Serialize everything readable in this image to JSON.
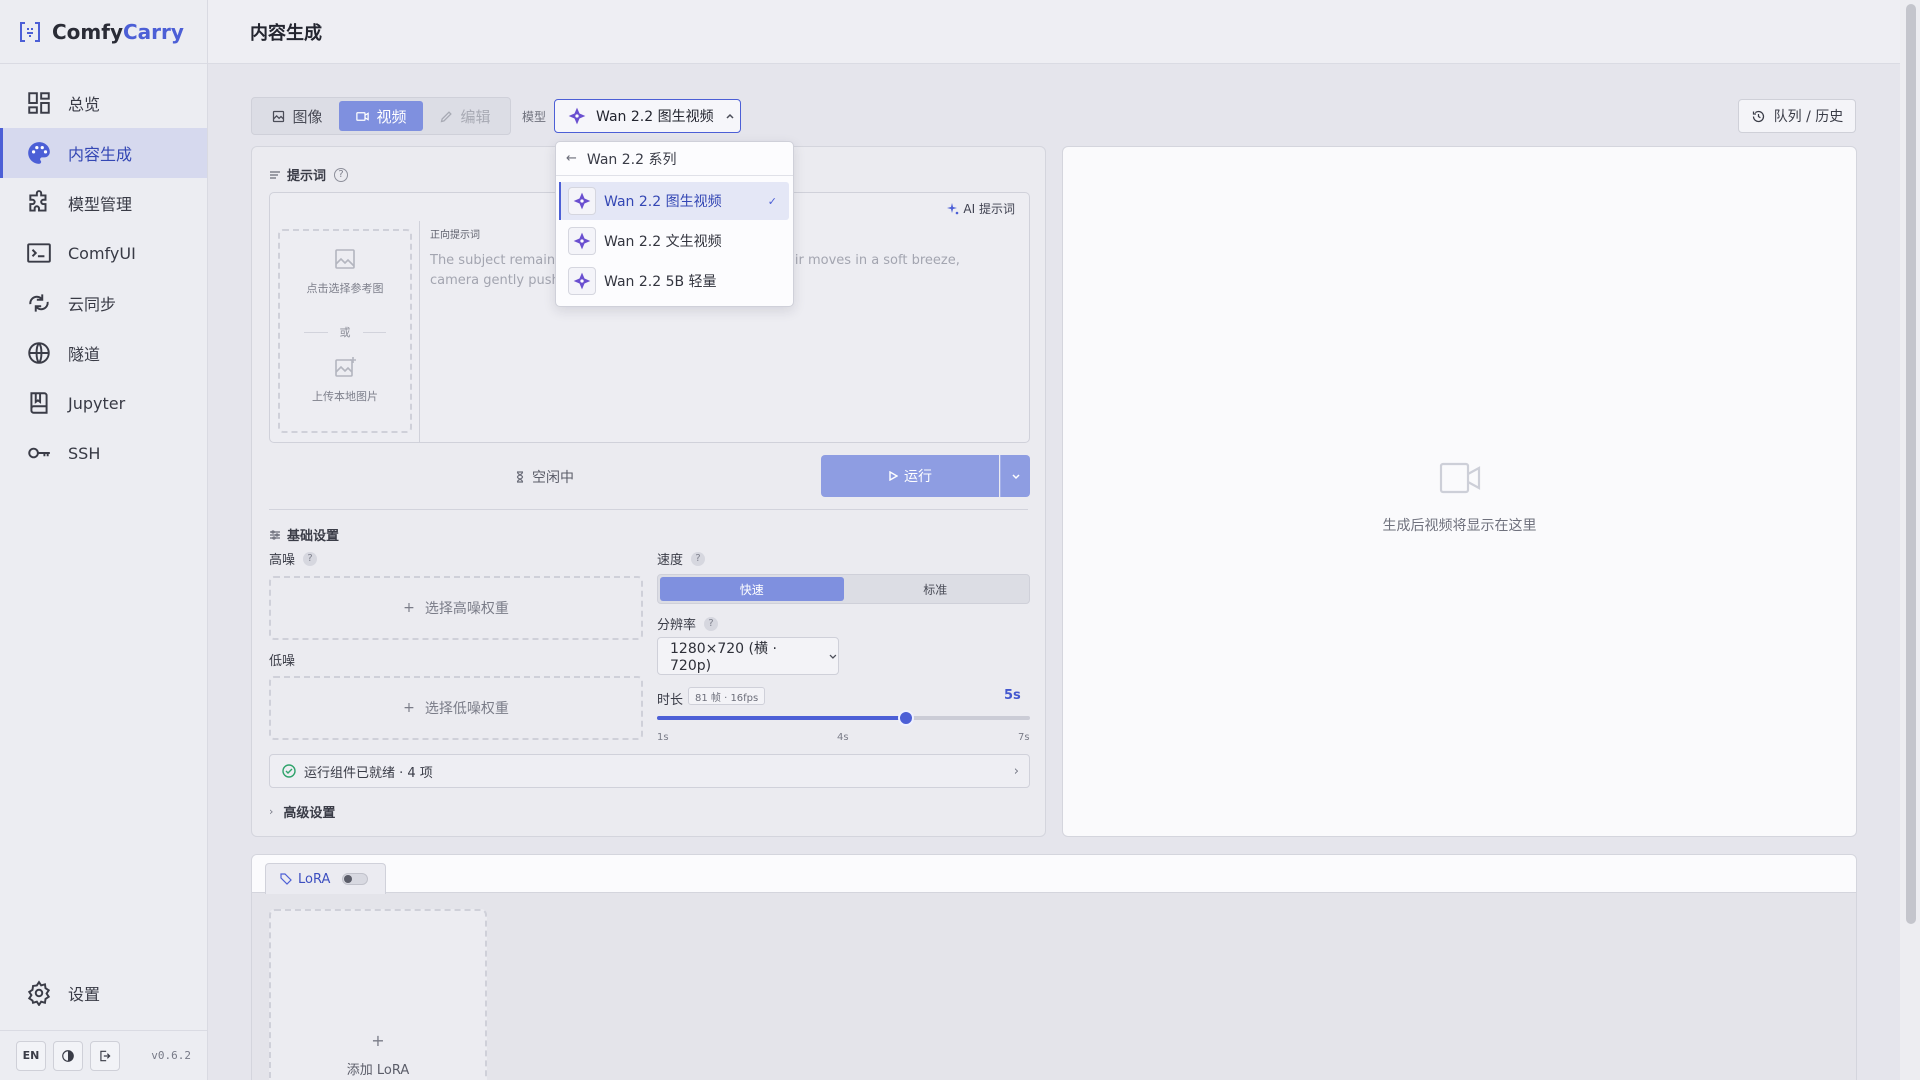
{
  "app": {
    "brand_prefix": "Comfy",
    "brand_accent": "Carry",
    "version": "v0.6.2",
    "accent_color": "#4c5fd6"
  },
  "sidebar": {
    "items": [
      {
        "label": "总览",
        "icon": "dashboard-icon"
      },
      {
        "label": "内容生成",
        "icon": "palette-icon",
        "active": true
      },
      {
        "label": "模型管理",
        "icon": "puzzle-icon"
      },
      {
        "label": "ComfyUI",
        "icon": "terminal-icon"
      },
      {
        "label": "云同步",
        "icon": "cloud-sync-icon"
      },
      {
        "label": "隧道",
        "icon": "globe-icon"
      },
      {
        "label": "Jupyter",
        "icon": "book-icon"
      },
      {
        "label": "SSH",
        "icon": "key-icon"
      }
    ],
    "settings_label": "设置",
    "lang_button": "EN"
  },
  "header": {
    "title": "内容生成"
  },
  "toolbar": {
    "tabs": [
      {
        "label": "图像",
        "icon": "image-icon"
      },
      {
        "label": "视频",
        "icon": "video-icon",
        "active": true
      },
      {
        "label": "编辑",
        "icon": "pencil-icon",
        "disabled": true
      }
    ],
    "model_label": "模型",
    "model_value": "Wan 2.2 图生视频",
    "queue_label": "队列 / 历史"
  },
  "dropdown": {
    "header": "Wan 2.2 系列",
    "options": [
      "Wan 2.2 图生视频",
      "Wan 2.2 文生视频",
      "Wan 2.2 5B 轻量"
    ],
    "selected_index": 0
  },
  "prompt": {
    "section_title": "提示词",
    "ai_prompt_label": "AI 提示词",
    "ref_select_label": "点击选择参考图",
    "ref_or": "或",
    "ref_upload_label": "上传本地图片",
    "positive_label": "正向提示词",
    "text_line1": "The subject remains",
    "text_line1_tail": "era; hair moves in a soft breeze,",
    "text_line2": "camera gently pushe"
  },
  "run": {
    "status": "空闲中",
    "button_label": "运行"
  },
  "basic": {
    "section_title": "基础设置",
    "high_noise_label": "高噪",
    "high_noise_button": "选择高噪权重",
    "low_noise_label": "低噪",
    "low_noise_button": "选择低噪权重",
    "speed_label": "速度",
    "speed_options": [
      "快速",
      "标准"
    ],
    "speed_selected": "快速",
    "resolution_label": "分辨率",
    "resolution_value": "1280×720 (横 · 720p)",
    "duration_label": "时长",
    "duration_badge": "81 帧 · 16fps",
    "duration_value": "5s",
    "duration_min": 1,
    "duration_max": 7,
    "duration_current": 5,
    "ticks": [
      "1s",
      "4s",
      "7s"
    ]
  },
  "ready": {
    "text": "运行组件已就绪 · 4 项"
  },
  "advanced": {
    "label": "高级设置"
  },
  "preview": {
    "empty_text": "生成后视频将显示在这里"
  },
  "lora": {
    "tab_label": "LoRA",
    "enabled": false,
    "add_label": "添加 LoRA"
  }
}
